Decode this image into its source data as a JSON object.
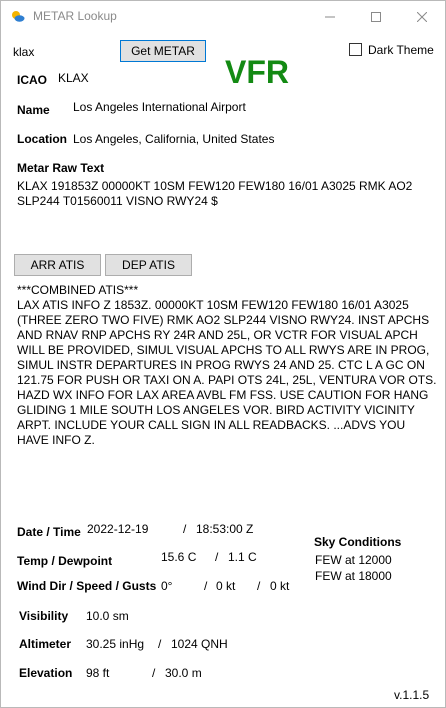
{
  "window": {
    "title": "METAR Lookup"
  },
  "search": {
    "value": "klax",
    "button_label": "Get METAR"
  },
  "flight_category": "VFR",
  "dark_theme": {
    "label": "Dark Theme",
    "checked": false
  },
  "station": {
    "icao_label": "ICAO",
    "icao_value": "KLAX",
    "name_label": "Name",
    "name_value": "Los Angeles International Airport",
    "location_label": "Location",
    "location_value": "Los Angeles, California, United States"
  },
  "metar": {
    "raw_label": "Metar Raw Text",
    "raw_text": "KLAX 191853Z 00000KT 10SM FEW120 FEW180 16/01 A3025 RMK AO2 SLP244 T01560011 VISNO RWY24 $"
  },
  "atis_buttons": {
    "arr_label": "ARR ATIS",
    "dep_label": "DEP ATIS"
  },
  "atis": {
    "header": "***COMBINED ATIS***",
    "text": "LAX ATIS INFO Z 1853Z. 00000KT 10SM FEW120 FEW180 16/01 A3025 (THREE ZERO TWO FIVE) RMK AO2 SLP244 VISNO RWY24. INST APCHS AND RNAV RNP APCHS RY 24R AND 25L, OR VCTR FOR VISUAL APCH WILL BE PROVIDED, SIMUL VISUAL APCHS TO ALL RWYS ARE IN PROG, SIMUL INSTR DEPARTURES IN PROG RWYS 24 AND 25. CTC L A GC ON 121.75 FOR PUSH OR TAXI ON A. PAPI OTS 24L, 25L, VENTURA VOR OTS. HAZD WX INFO FOR LAX AREA AVBL FM FSS. USE CAUTION FOR HANG GLIDING 1 MILE SOUTH LOS ANGELES VOR. BIRD ACTIVITY VICINITY ARPT. INCLUDE YOUR CALL SIGN IN ALL READBACKS. ...ADVS YOU HAVE INFO Z."
  },
  "conditions": {
    "datetime_label": "Date / Time",
    "date_value": "2022-12-19",
    "time_value": "18:53:00 Z",
    "temp_label": "Temp / Dewpoint",
    "temp_value": "15.6 C",
    "dewpoint_value": "1.1 C",
    "wind_label": "Wind Dir / Speed / Gusts",
    "wind_dir": "0°",
    "wind_speed": "0 kt",
    "wind_gusts": "0 kt",
    "visibility_label": "Visibility",
    "visibility_value": "10.0 sm",
    "altimeter_label": "Altimeter",
    "altimeter_inhg": "30.25 inHg",
    "altimeter_qnh": "1024 QNH",
    "elevation_label": "Elevation",
    "elevation_ft": "98 ft",
    "elevation_m": "30.0 m",
    "separator": "/"
  },
  "sky": {
    "label": "Sky Conditions",
    "layers": [
      "FEW at 12000",
      "FEW at 18000"
    ]
  },
  "version": "v.1.1.5",
  "colors": {
    "vfr": "#138a13",
    "button_bg": "#e1e1e1",
    "focus_border": "#0078d4"
  }
}
